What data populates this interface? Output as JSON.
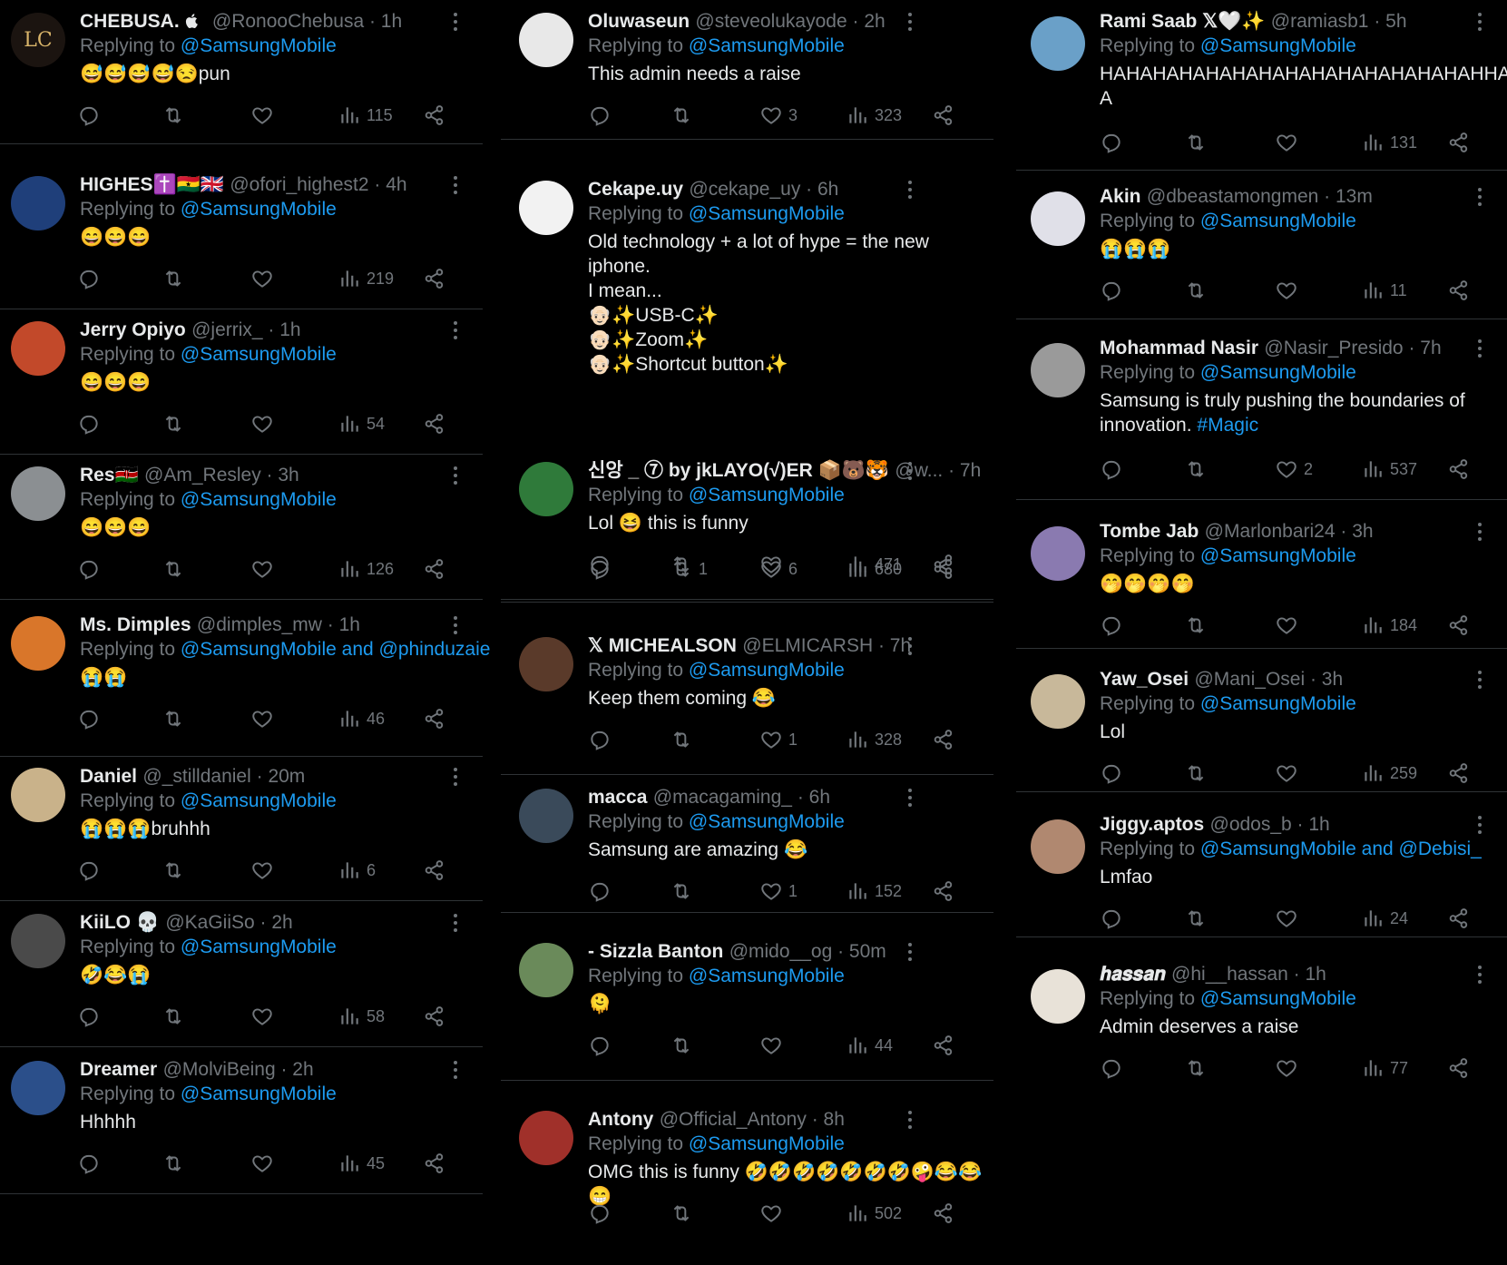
{
  "columns": [
    {
      "tweets": [
        {
          "name": "CHEBUSA. ",
          "handle": "@RonooChebusa",
          "time": " · 1h",
          "replying_prefix": "Replying to ",
          "replying_to": "@SamsungMobile",
          "text": "😅😅😅😅😒pun",
          "replies": "",
          "retweets": "",
          "likes": "",
          "views": "115",
          "avatar_color": "#1b1410",
          "avatar_label": "LC"
        },
        {
          "name": "HIGHES✝️🇬🇭🇬🇧",
          "handle": "@ofori_highest2",
          "time": " · 4h",
          "replying_prefix": "Replying to ",
          "replying_to": "@SamsungMobile",
          "text": "😄😄😄",
          "replies": "",
          "retweets": "",
          "likes": "",
          "views": "219",
          "avatar_color": "#1f3f7a",
          "avatar_label": ""
        },
        {
          "name": "Jerry Opiyo",
          "handle": "@jerrix_",
          "time": " · 1h",
          "replying_prefix": "Replying to ",
          "replying_to": "@SamsungMobile",
          "text": "😄😄😄",
          "replies": "",
          "retweets": "",
          "likes": "",
          "views": "54",
          "avatar_color": "#c2492a",
          "avatar_label": ""
        },
        {
          "name": "Res🇰🇪",
          "handle": "@Am_Resley",
          "time": " · 3h",
          "replying_prefix": "Replying to ",
          "replying_to": "@SamsungMobile",
          "text": "😄😄😄",
          "replies": "",
          "retweets": "",
          "likes": "",
          "views": "126",
          "avatar_color": "#8b8f92",
          "avatar_label": ""
        },
        {
          "name": "Ms. Dimples",
          "handle": "@dimples_mw",
          "time": " · 1h",
          "replying_prefix": "Replying to ",
          "replying_to": "@SamsungMobile and @phinduzaie",
          "text": "😭😭",
          "replies": "",
          "retweets": "",
          "likes": "",
          "views": "46",
          "avatar_color": "#d9762a",
          "avatar_label": ""
        },
        {
          "name": "Daniel",
          "handle": "@_stilldaniel",
          "time": " · 20m",
          "replying_prefix": "Replying to ",
          "replying_to": "@SamsungMobile",
          "text": "😭😭😭bruhhh",
          "replies": "",
          "retweets": "",
          "likes": "",
          "views": "6",
          "avatar_color": "#c9b28a",
          "avatar_label": ""
        },
        {
          "name": "KiiLO 💀",
          "handle": "@KaGiiSo",
          "time": " · 2h",
          "replying_prefix": "Replying to ",
          "replying_to": "@SamsungMobile",
          "text": "🤣😂😭",
          "replies": "",
          "retweets": "",
          "likes": "",
          "views": "58",
          "avatar_color": "#4a4a4a",
          "avatar_label": ""
        },
        {
          "name": "Dreamer",
          "handle": "@MolviBeing",
          "time": " · 2h",
          "replying_prefix": "Replying to ",
          "replying_to": "@SamsungMobile",
          "text": "Hhhhh",
          "replies": "",
          "retweets": "",
          "likes": "",
          "views": "45",
          "avatar_color": "#2b4f8a",
          "avatar_label": ""
        }
      ]
    },
    {
      "tweets": [
        {
          "name": "Oluwaseun",
          "handle": "@steveolukayode",
          "time": " · 2h",
          "replying_prefix": "Replying to ",
          "replying_to": "@SamsungMobile",
          "text": "This admin needs a raise",
          "replies": "",
          "retweets": "",
          "likes": "3",
          "views": "323",
          "avatar_color": "#e8e8e8",
          "avatar_label": ""
        },
        {
          "name": "Cekape.uy",
          "handle": "@cekape_uy",
          "time": " · 6h",
          "replying_prefix": "Replying to ",
          "replying_to": "@SamsungMobile",
          "text": "Old technology + a lot of hype = the new\niphone.\nI mean...\n👴🏻✨USB-C✨\n👴🏻✨Zoom✨\n👴🏻✨Shortcut button✨",
          "replies": "",
          "retweets": "1",
          "likes": "6",
          "views": "680",
          "avatar_color": "#f2f2f2",
          "avatar_label": ""
        },
        {
          "name": "신앙 _ ⑦ by jkLAYO(√)ER 📦🐻🐯",
          "handle": "@w...",
          "time": " · 7h",
          "replying_prefix": "Replying to ",
          "replying_to": "@SamsungMobile",
          "text": "Lol 😆 this is funny",
          "replies": "",
          "retweets": "",
          "likes": "",
          "views": "471",
          "avatar_color": "#2f7a3a",
          "avatar_label": ""
        },
        {
          "name": "𝕏 MICHEALSON",
          "handle": "@ELMICARSH",
          "time": " · 7h",
          "replying_prefix": "Replying to ",
          "replying_to": "@SamsungMobile",
          "text": "Keep them coming 😂",
          "replies": "",
          "retweets": "",
          "likes": "1",
          "views": "328",
          "avatar_color": "#5a3a2a",
          "avatar_label": ""
        },
        {
          "name": "macca",
          "handle": "@macagaming_",
          "time": " · 6h",
          "replying_prefix": "Replying to ",
          "replying_to": "@SamsungMobile",
          "text": "Samsung are amazing 😂",
          "replies": "",
          "retweets": "",
          "likes": "1",
          "views": "152",
          "avatar_color": "#3a4a5a",
          "avatar_label": ""
        },
        {
          "name": "- Sizzla Banton",
          "handle": "@mido__og",
          "time": " · 50m",
          "replying_prefix": "Replying to ",
          "replying_to": "@SamsungMobile",
          "text": "🫠",
          "replies": "",
          "retweets": "",
          "likes": "",
          "views": "44",
          "avatar_color": "#6a8a5a",
          "avatar_label": ""
        },
        {
          "name": "Antony",
          "handle": "@Official_Antony",
          "time": " · 8h",
          "replying_prefix": "Replying to ",
          "replying_to": "@SamsungMobile",
          "text": "OMG this is funny 🤣🤣🤣🤣🤣🤣🤣🤪😂😂😁",
          "replies": "",
          "retweets": "",
          "likes": "",
          "views": "502",
          "avatar_color": "#a0302a",
          "avatar_label": ""
        }
      ]
    },
    {
      "tweets": [
        {
          "name": "Rami Saab 𝕏🤍✨",
          "handle": "@ramiasb1",
          "time": " · 5h",
          "replying_prefix": "Replying to ",
          "replying_to": "@SamsungMobile",
          "text": "HAHAHAHAHAHAHAHAHAHAHAHAHAHAHHAH\nA",
          "replies": "",
          "retweets": "",
          "likes": "",
          "views": "131",
          "avatar_color": "#6aa0c8",
          "avatar_label": ""
        },
        {
          "name": "Akin",
          "handle": "@dbeastamongmen",
          "time": " · 13m",
          "replying_prefix": "Replying to ",
          "replying_to": "@SamsungMobile",
          "text": "😭😭😭",
          "replies": "",
          "retweets": "",
          "likes": "",
          "views": "11",
          "avatar_color": "#e0e0e8",
          "avatar_label": ""
        },
        {
          "name": "Mohammad Nasir",
          "handle": "@Nasir_Presido",
          "time": " · 7h",
          "replying_prefix": "Replying to ",
          "replying_to": "@SamsungMobile",
          "text": "Samsung is truly pushing the boundaries of\ninnovation. #Magic",
          "replies": "",
          "retweets": "",
          "likes": "2",
          "views": "537",
          "avatar_color": "#9a9a9a",
          "avatar_label": ""
        },
        {
          "name": "Tombe Jab",
          "handle": "@Marlonbari24",
          "time": " · 3h",
          "replying_prefix": "Replying to ",
          "replying_to": "@SamsungMobile",
          "text": "🤭🤭🤭🤭",
          "replies": "",
          "retweets": "",
          "likes": "",
          "views": "184",
          "avatar_color": "#8a7ab0",
          "avatar_label": ""
        },
        {
          "name": "Yaw_Osei",
          "handle": "@Mani_Osei",
          "time": " · 3h",
          "replying_prefix": "Replying to ",
          "replying_to": "@SamsungMobile",
          "text": "Lol",
          "replies": "",
          "retweets": "",
          "likes": "",
          "views": "259",
          "avatar_color": "#c8b89a",
          "avatar_label": ""
        },
        {
          "name": "Jiggy.aptos",
          "handle": "@odos_b",
          "time": " · 1h",
          "replying_prefix": "Replying to ",
          "replying_to": "@SamsungMobile and @Debisi_",
          "text": "Lmfao",
          "replies": "",
          "retweets": "",
          "likes": "",
          "views": "24",
          "avatar_color": "#b08870",
          "avatar_label": ""
        },
        {
          "name": "𝒉𝒂𝒔𝒔𝒂𝒏",
          "handle": "@hi__hassan",
          "time": " · 1h",
          "replying_prefix": "Replying to ",
          "replying_to": "@SamsungMobile",
          "text": "Admin deserves a raise",
          "replies": "",
          "retweets": "",
          "likes": "",
          "views": "77",
          "avatar_color": "#e8e2d8",
          "avatar_label": ""
        }
      ]
    }
  ],
  "colors": {
    "background": "#000000",
    "text": "#e7e9ea",
    "muted": "#71767b",
    "link": "#1d9bf0",
    "divider": "#2f3336"
  },
  "icons": [
    "reply-icon",
    "retweet-icon",
    "like-icon",
    "views-icon",
    "share-icon",
    "more-options-icon",
    "apple-icon"
  ]
}
